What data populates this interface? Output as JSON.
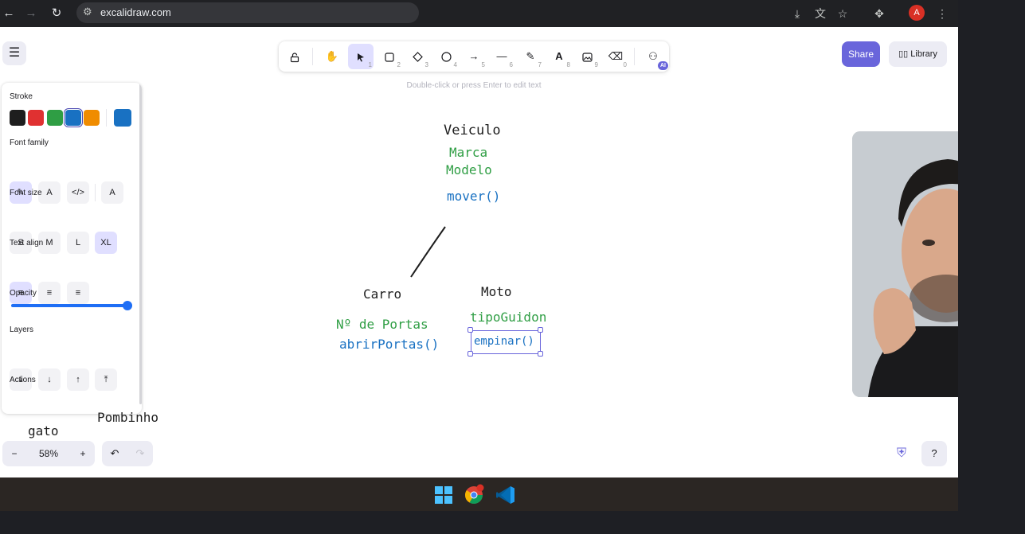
{
  "browser": {
    "url": "excalidraw.com",
    "profile_initial": "A",
    "icons": [
      "back-arrow-icon",
      "forward-arrow-icon",
      "reload-icon",
      "site-settings-icon",
      "install-app-icon",
      "translate-icon",
      "bookmark-star-icon",
      "extensions-icon",
      "more-vert-icon"
    ]
  },
  "toolbar": {
    "tools": [
      {
        "name": "lock",
        "key": ""
      },
      {
        "name": "hand",
        "key": ""
      },
      {
        "name": "selection",
        "key": "1"
      },
      {
        "name": "rectangle",
        "key": "2"
      },
      {
        "name": "diamond",
        "key": "3"
      },
      {
        "name": "ellipse",
        "key": "4"
      },
      {
        "name": "arrow",
        "key": "5"
      },
      {
        "name": "line",
        "key": "6"
      },
      {
        "name": "draw",
        "key": "7"
      },
      {
        "name": "text",
        "key": "8"
      },
      {
        "name": "image",
        "key": "9"
      },
      {
        "name": "eraser",
        "key": "0"
      }
    ],
    "ai_badge": "AI",
    "active_tool": "selection"
  },
  "header": {
    "share_label": "Share",
    "library_label": "Library",
    "hint": "Double-click or press Enter to edit text"
  },
  "panel": {
    "stroke_title": "Stroke",
    "stroke_colors": [
      "#1e1e1e",
      "#e03131",
      "#2f9e44",
      "#1971c2",
      "#f08c00"
    ],
    "selected_stroke": "#1971c2",
    "font_family_title": "Font family",
    "font_size_title": "Font size",
    "font_sizes": [
      "S",
      "M",
      "L",
      "XL"
    ],
    "selected_font_size": "XL",
    "text_align_title": "Text align",
    "opacity_title": "Opacity",
    "opacity_value": 100,
    "layers_title": "Layers",
    "actions_title": "Actions"
  },
  "footer": {
    "zoom_out": "−",
    "zoom_level": "58%",
    "zoom_in": "+"
  },
  "canvas": {
    "texts": {
      "veiculo": "Veiculo",
      "marca": "Marca",
      "modelo": "Modelo",
      "mover": "mover()",
      "carro": "Carro",
      "moto": "Moto",
      "portas": "Nº de Portas",
      "abrir": "abrirPortas()",
      "tipo_guidon": "tipoGuidon",
      "empinar": "empinar()",
      "pombinho": "Pombinho",
      "gato": "gato"
    }
  }
}
